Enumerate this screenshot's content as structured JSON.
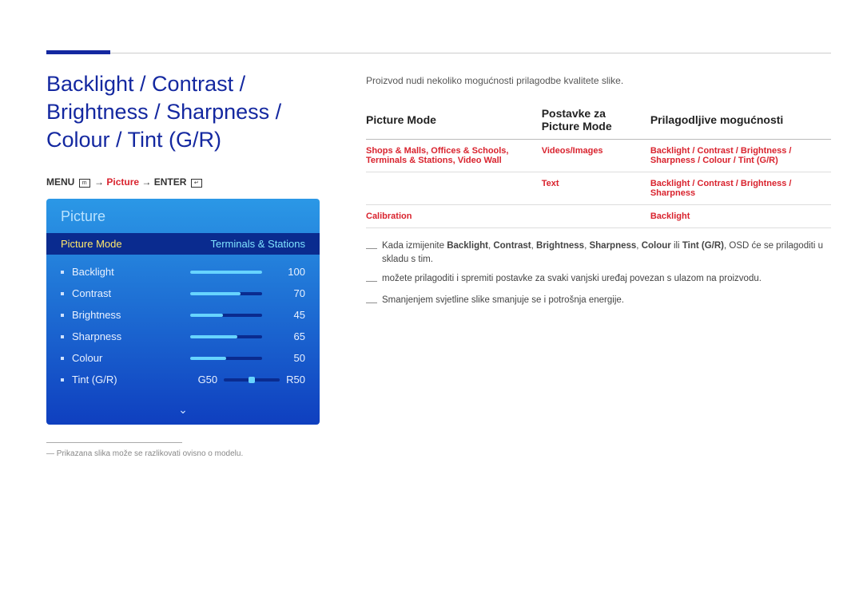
{
  "heading": "Backlight / Contrast / Brightness / Sharpness / Colour / Tint (G/R)",
  "breadcrumb": {
    "menu": "MENU",
    "arrow": "→",
    "picture": "Picture",
    "enter": "ENTER"
  },
  "osd": {
    "title": "Picture",
    "selected_label": "Picture Mode",
    "selected_value": "Terminals & Stations",
    "items": [
      {
        "name": "Backlight",
        "value": 100,
        "fill": 100
      },
      {
        "name": "Contrast",
        "value": 70,
        "fill": 70
      },
      {
        "name": "Brightness",
        "value": 45,
        "fill": 45
      },
      {
        "name": "Sharpness",
        "value": 65,
        "fill": 65
      },
      {
        "name": "Colour",
        "value": 50,
        "fill": 50
      }
    ],
    "tint": {
      "name": "Tint (G/R)",
      "g": "G50",
      "r": "R50"
    },
    "chevron": "⌄"
  },
  "footnote": "Prikazana slika može se razlikovati ovisno o modelu.",
  "desc": "Proizvod nudi nekoliko mogućnosti prilagodbe kvalitete slike.",
  "table": {
    "headers": [
      "Picture Mode",
      "Postavke za Picture Mode",
      "Prilagodljive mogućnosti"
    ],
    "rows": [
      {
        "c1": "Shops & Malls, Offices & Schools, Terminals & Stations, Video Wall",
        "c2": "Videos/Images",
        "c3": "Backlight / Contrast / Brightness / Sharpness / Colour / Tint (G/R)"
      },
      {
        "c1": "",
        "c2": "Text",
        "c3": "Backlight / Contrast / Brightness / Sharpness"
      },
      {
        "c1": "Calibration",
        "c2": "",
        "c3": "Backlight"
      }
    ]
  },
  "notes": [
    {
      "prefix": "Kada izmijenite ",
      "bolds": [
        "Backlight",
        "Contrast",
        "Brightness",
        "Sharpness",
        "Colour",
        "Tint (G/R)"
      ],
      "mid": " ili ",
      "sep": ", ",
      "suffix": ", OSD će se prilagoditi u skladu s tim."
    },
    {
      "text": "možete prilagoditi i spremiti postavke za svaki vanjski uređaj povezan s ulazom na proizvodu."
    },
    {
      "text": "Smanjenjem svjetline slike smanjuje se i potrošnja energije."
    }
  ]
}
